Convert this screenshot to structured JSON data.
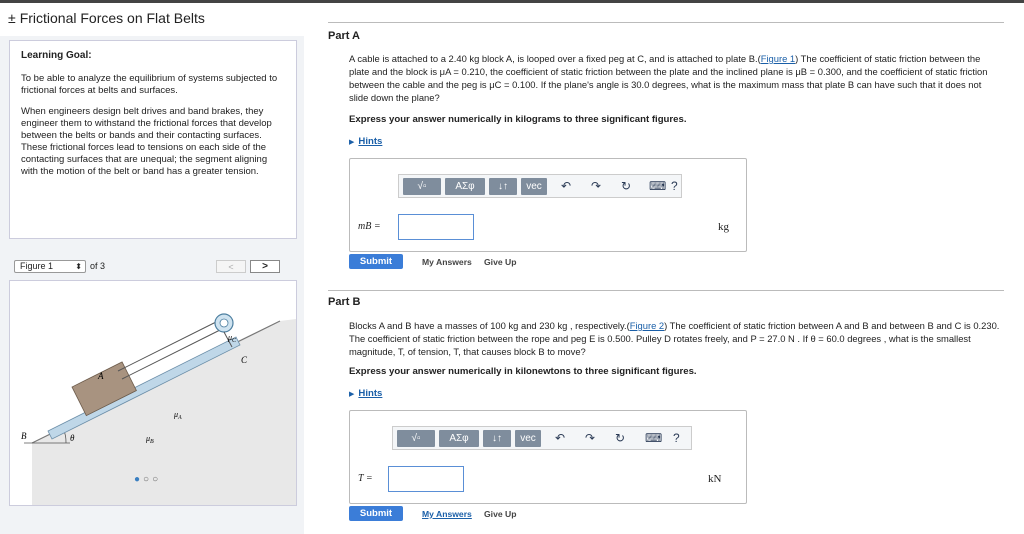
{
  "title": "Frictional Forces on Flat Belts",
  "title_icon": "plus-minus-icon",
  "learning_goal": {
    "heading": "Learning Goal:",
    "p1": "To be able to analyze the equilibrium of systems subjected to frictional forces at belts and surfaces.",
    "p2": "When engineers design belt drives and band brakes, they engineer them to withstand the frictional forces that develop between the belts or bands and their contacting surfaces. These frictional forces lead to tensions on each side of the contacting surfaces that are unequal; the segment aligning with the motion of the belt or band has a greater tension."
  },
  "figure": {
    "selected": "Figure 1",
    "of_text": "of 3",
    "prev": "<",
    "next": ">",
    "labels": {
      "A": "A",
      "B": "B",
      "C": "C",
      "theta": "θ",
      "muA": "μ",
      "muA_sub": "A",
      "muB": "μ",
      "muB_sub": "B",
      "muC": "μ",
      "muC_sub": "C"
    }
  },
  "partA": {
    "title": "Part A",
    "text_1": "A cable is attached to a 2.40 kg block A, is looped over a fixed peg at C, and is attached to plate B.(",
    "link": "Figure 1",
    "text_2": ") The coefficient of static friction between the plate and the block is μA = 0.210, the coefficient of static friction between the plate and the inclined plane is μB = 0.300, and the coefficient of static friction between the cable and the peg is μC = 0.100. If the plane's angle is 30.0 degrees, what is the maximum mass that plate B can have such that it does not slide down the plane?",
    "express": "Express your answer numerically in kilograms to three significant figures.",
    "hints": "Hints",
    "var_label": "mB =",
    "unit": "kg",
    "submit": "Submit",
    "my_answers": "My Answers",
    "give_up": "Give Up"
  },
  "partB": {
    "title": "Part B",
    "text_1": "Blocks A and B have a masses of 100 kg and 230 kg , respectively.(",
    "link": "Figure 2",
    "text_2": ") The coefficient of static friction between A and B and between B and C is 0.230. The coefficient of static friction between the rope and peg E is 0.500. Pulley D rotates freely, and P = 27.0 N . If θ = 60.0 degrees , what is the smallest magnitude, T, of tension, T, that causes block B to move?",
    "express": "Express your answer numerically in kilonewtons to three significant figures.",
    "hints": "Hints",
    "var_label": "T =",
    "unit": "kN",
    "submit": "Submit",
    "my_answers": "My Answers",
    "give_up": "Give Up"
  },
  "toolbar": {
    "sqrt": "√▫",
    "greek": "ΑΣφ",
    "arrows": "↓↑",
    "vec": "vec",
    "undo": "↶",
    "redo": "↷",
    "reset": "↻",
    "keyboard": "⌨",
    "help": "?"
  },
  "pager": {
    "active_dot": "●",
    "dots": "○○"
  }
}
